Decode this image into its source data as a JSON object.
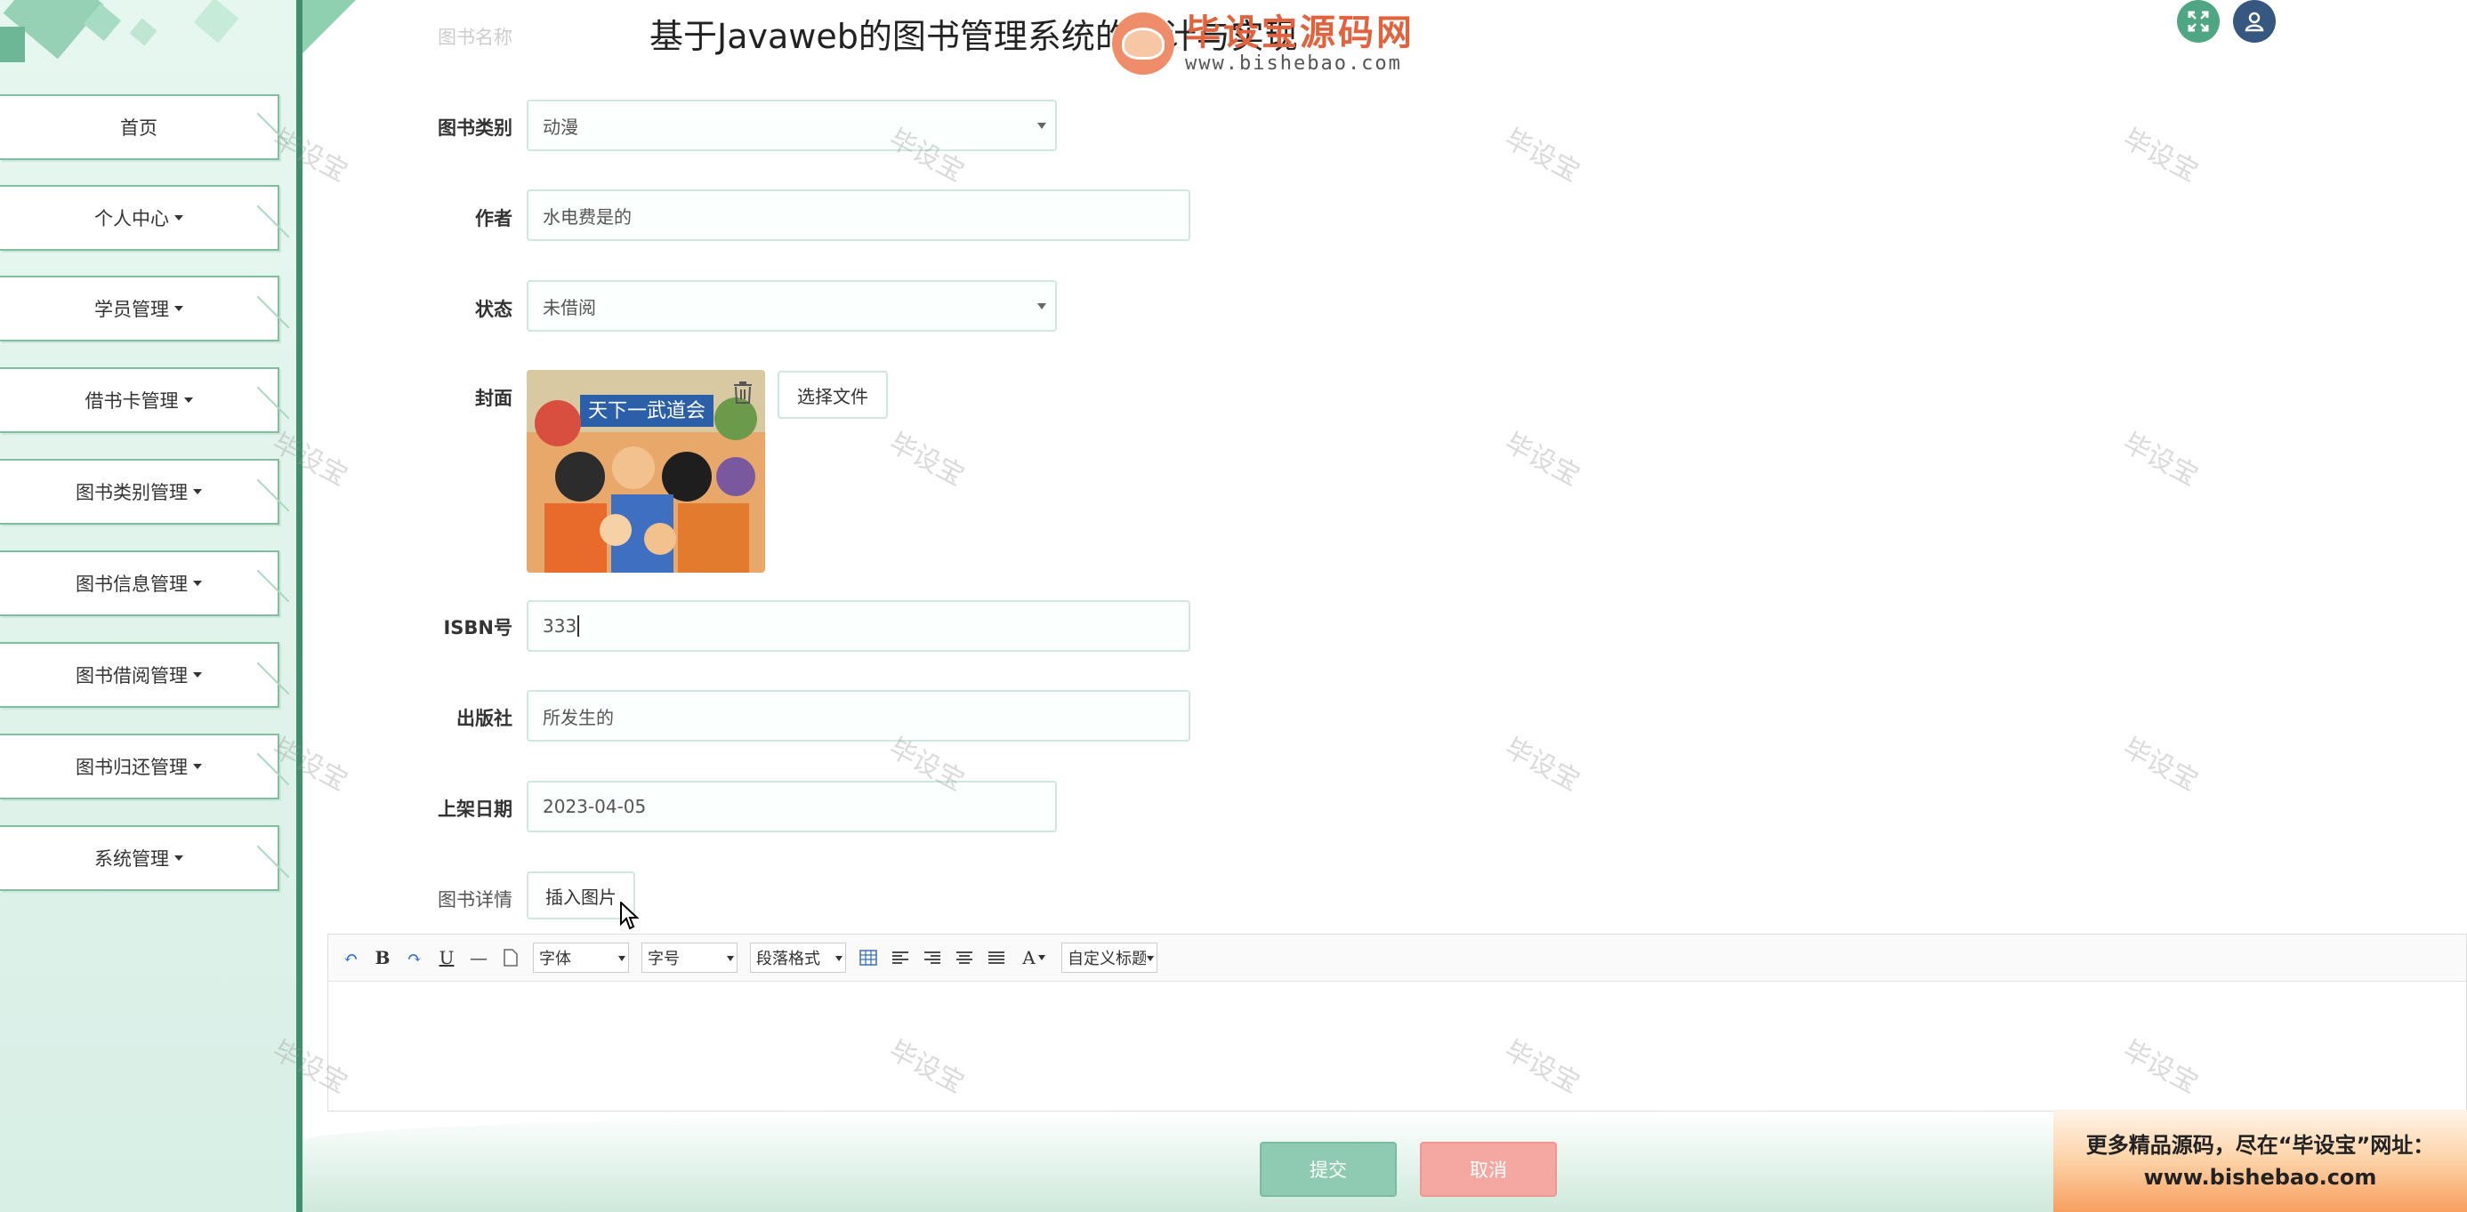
{
  "header": {
    "title": "基于Javaweb的图书管理系统的设计与实现",
    "hidden_label": "图书名称",
    "logo_main": "毕设宝源码网",
    "logo_url": "www.bishebao.com"
  },
  "sidebar": {
    "items": [
      {
        "label": "首页",
        "has_caret": false
      },
      {
        "label": "个人中心",
        "has_caret": true
      },
      {
        "label": "学员管理",
        "has_caret": true
      },
      {
        "label": "借书卡管理",
        "has_caret": true
      },
      {
        "label": "图书类别管理",
        "has_caret": true
      },
      {
        "label": "图书信息管理",
        "has_caret": true
      },
      {
        "label": "图书借阅管理",
        "has_caret": true
      },
      {
        "label": "图书归还管理",
        "has_caret": true
      },
      {
        "label": "系统管理",
        "has_caret": true
      }
    ]
  },
  "form": {
    "category": {
      "label": "图书类别",
      "value": "动漫"
    },
    "author": {
      "label": "作者",
      "value": "水电费是的"
    },
    "status": {
      "label": "状态",
      "value": "未借阅"
    },
    "cover": {
      "label": "封面",
      "choose_file": "选择文件",
      "image_text": "天下一武道会"
    },
    "isbn": {
      "label": "ISBN号",
      "value": "333"
    },
    "publisher": {
      "label": "出版社",
      "value": "所发生的"
    },
    "shelf_date": {
      "label": "上架日期",
      "value": "2023-04-05"
    },
    "details": {
      "label": "图书详情",
      "insert_image": "插入图片"
    }
  },
  "editor": {
    "font_label": "字体",
    "size_label": "字号",
    "paragraph_label": "段落格式",
    "custom_title_label": "自定义标题",
    "font_color_glyph": "A"
  },
  "actions": {
    "submit": "提交",
    "cancel": "取消"
  },
  "ad": {
    "line1": "更多精品源码，尽在“毕设宝”网址：",
    "line2": "www.bishebao.com"
  },
  "watermark_text": "毕设宝",
  "colors": {
    "accent": "#3f8f6e",
    "submit": "#8fcbb3",
    "cancel": "#f5a8a2",
    "user_btn": "#36577f",
    "expand_btn": "#4fa685"
  }
}
